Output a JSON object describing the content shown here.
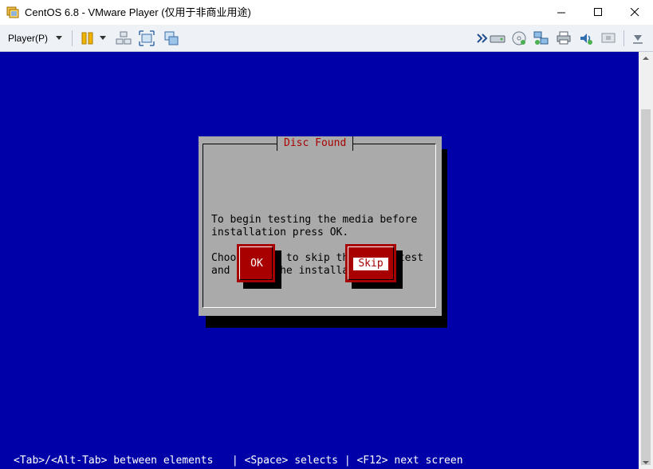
{
  "window": {
    "title": "CentOS 6.8 - VMware Player (仅用于非商业用途)"
  },
  "toolbar": {
    "player_menu_label": "Player(P)",
    "icons": [
      "pause-icon",
      "send-ctrl-alt-del-icon",
      "fullscreen-icon",
      "unity-icon",
      "more-arrow-icon",
      "hard-disk-icon",
      "cd-dvd-icon",
      "network-adapter-icon",
      "printer-icon",
      "sound-card-icon",
      "display-icon",
      "collapse-toolbar-icon"
    ]
  },
  "dialog": {
    "title": "Disc Found",
    "line1": "To begin testing the media before",
    "line2": "installation press OK.",
    "line3": "Choose Skip to skip the media test",
    "line4": "and start the installation.",
    "ok_label": "OK",
    "skip_label": "Skip"
  },
  "hint_line": "<Tab>/<Alt-Tab> between elements   | <Space> selects | <F12> next screen",
  "colors": {
    "screen_bg": "#0000a8",
    "dialog_bg": "#aaaaaa",
    "button_red": "#a80000",
    "title_red": "#a80000"
  }
}
